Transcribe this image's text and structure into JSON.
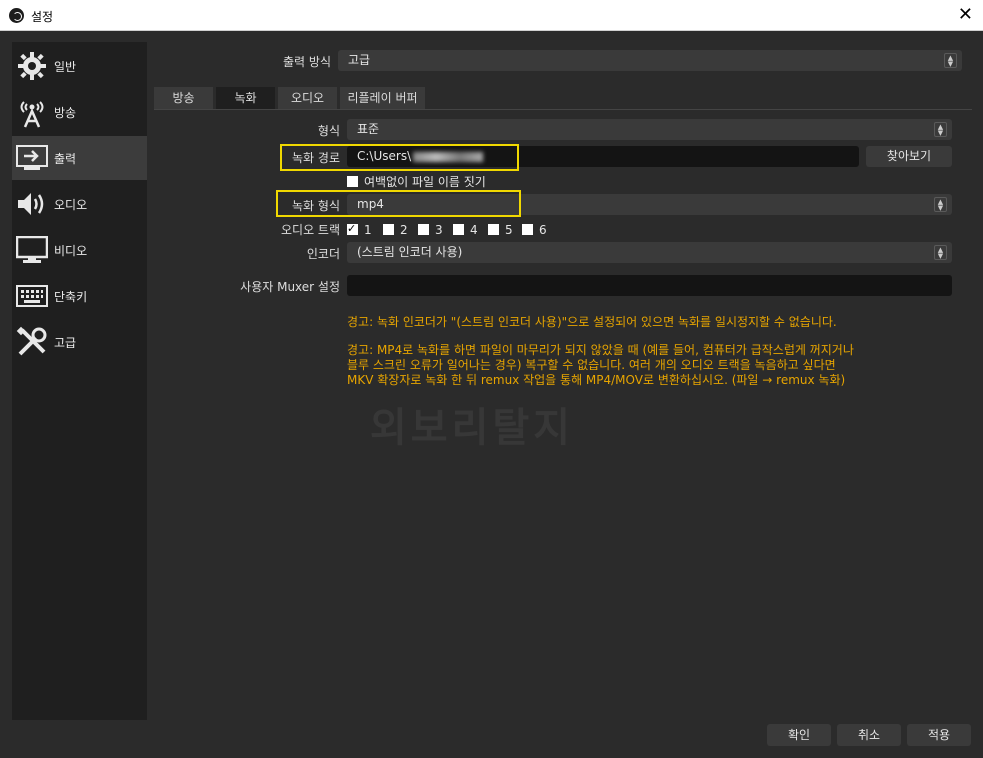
{
  "window": {
    "title": "설정",
    "close_glyph": "✕"
  },
  "sidebar": {
    "items": [
      {
        "label": "일반",
        "icon": "gear-icon"
      },
      {
        "label": "방송",
        "icon": "broadcast-icon"
      },
      {
        "label": "출력",
        "icon": "output-icon",
        "active": true
      },
      {
        "label": "오디오",
        "icon": "speaker-icon"
      },
      {
        "label": "비디오",
        "icon": "monitor-icon"
      },
      {
        "label": "단축키",
        "icon": "keyboard-icon"
      },
      {
        "label": "고급",
        "icon": "tools-icon"
      }
    ]
  },
  "output_mode": {
    "label": "출력 방식",
    "value": "고급"
  },
  "tabs": [
    {
      "label": "방송"
    },
    {
      "label": "녹화",
      "active": true
    },
    {
      "label": "오디오"
    },
    {
      "label": "리플레이 버퍼"
    }
  ],
  "recording": {
    "type_label": "형식",
    "type_value": "표준",
    "path_label": "녹화 경로",
    "path_value": "C:\\Users\\",
    "browse_label": "찾아보기",
    "no_space_label": "여백없이 파일 이름 짓기",
    "format_label": "녹화 형식",
    "format_value": "mp4",
    "audio_track_label": "오디오 트랙",
    "tracks": [
      {
        "label": "1",
        "checked": true
      },
      {
        "label": "2",
        "checked": false
      },
      {
        "label": "3",
        "checked": false
      },
      {
        "label": "4",
        "checked": false
      },
      {
        "label": "5",
        "checked": false
      },
      {
        "label": "6",
        "checked": false
      }
    ],
    "encoder_label": "인코더",
    "encoder_value": "(스트림 인코더 사용)",
    "muxer_label": "사용자 Muxer 설정",
    "muxer_value": ""
  },
  "warnings": {
    "pause_warning": "경고: 녹화 인코더가 \"(스트림 인코더 사용)\"으로 설정되어 있으면 녹화를 일시정지할 수 없습니다.",
    "mp4_warning_line1": "경고: MP4로 녹화를 하면 파일이 마무리가 되지 않았을 때 (예를 들어, 컴퓨터가 급작스럽게 꺼지거나",
    "mp4_warning_line2": "블루 스크린 오류가 일어나는 경우) 복구할 수 없습니다. 여러 개의 오디오 트랙을 녹음하고 싶다면",
    "mp4_warning_line3": "MKV 확장자로 녹화 한 뒤 remux 작업을 통해 MP4/MOV로 변환하십시오. (파일 → remux 녹화)",
    "color": "#e6a400"
  },
  "watermark": "외보리탈지",
  "footer": {
    "ok": "확인",
    "cancel": "취소",
    "apply": "적용"
  },
  "colors": {
    "highlight": "#f0d800",
    "background": "#2b2b2b",
    "sidebar": "#1f1f1f"
  }
}
